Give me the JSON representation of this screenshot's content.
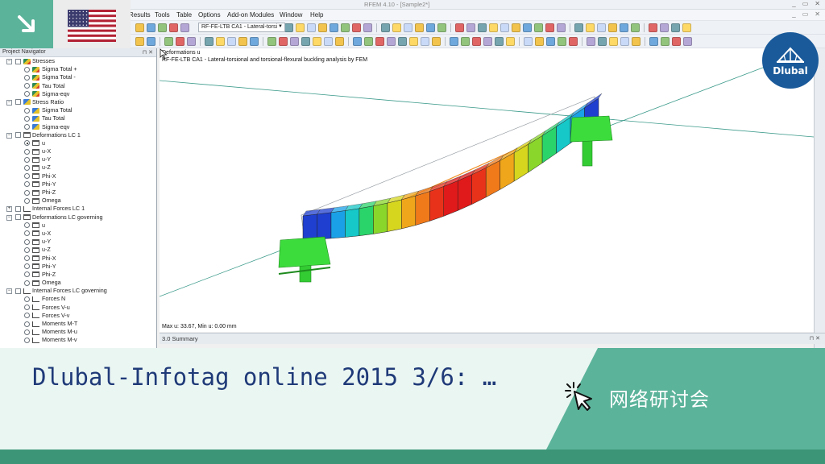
{
  "window": {
    "title": "RFEM 4.10 - [Sample2*]",
    "win_buttons": [
      "_",
      "▭",
      "✕"
    ]
  },
  "menu": {
    "items": [
      "Results",
      "Tools",
      "Table",
      "Options",
      "Add-on Modules",
      "Window",
      "Help"
    ]
  },
  "toolbar": {
    "load_case_select": "RF-FE-LTB CA1 - Lateral-torsi"
  },
  "navigator": {
    "title": "Project Navigator",
    "pin": "⊓ ✕",
    "rows": [
      {
        "level": 0,
        "type": "folder",
        "icon": "stress-icon",
        "label": "Stresses"
      },
      {
        "level": 1,
        "type": "radio",
        "icon": "stress-icon",
        "label": "Sigma Total +"
      },
      {
        "level": 1,
        "type": "radio",
        "icon": "stress-icon",
        "label": "Sigma Total -"
      },
      {
        "level": 1,
        "type": "radio",
        "icon": "stress-icon",
        "label": "Tau Total"
      },
      {
        "level": 1,
        "type": "radio",
        "icon": "stress-icon",
        "label": "Sigma-eqv"
      },
      {
        "level": 0,
        "type": "folder",
        "icon": "ratio-icon",
        "label": "Stress Ratio"
      },
      {
        "level": 1,
        "type": "radio",
        "icon": "ratio-icon",
        "label": "Sigma Total"
      },
      {
        "level": 1,
        "type": "radio",
        "icon": "ratio-icon",
        "label": "Tau Total"
      },
      {
        "level": 1,
        "type": "radio",
        "icon": "ratio-icon",
        "label": "Sigma-eqv"
      },
      {
        "level": 0,
        "type": "folder",
        "icon": "beam-icon",
        "label": "Deformations LC 1"
      },
      {
        "level": 1,
        "type": "radio",
        "icon": "beam-icon",
        "label": "u",
        "selected": true
      },
      {
        "level": 1,
        "type": "radio",
        "icon": "beam-icon",
        "label": "u-X"
      },
      {
        "level": 1,
        "type": "radio",
        "icon": "beam-icon",
        "label": "u-Y"
      },
      {
        "level": 1,
        "type": "radio",
        "icon": "beam-icon",
        "label": "u-Z"
      },
      {
        "level": 1,
        "type": "radio",
        "icon": "beam-icon",
        "label": "Phi-X"
      },
      {
        "level": 1,
        "type": "radio",
        "icon": "beam-icon",
        "label": "Phi-Y"
      },
      {
        "level": 1,
        "type": "radio",
        "icon": "beam-icon",
        "label": "Phi-Z"
      },
      {
        "level": 1,
        "type": "radio",
        "icon": "beam-icon",
        "label": "Omega"
      },
      {
        "level": 0,
        "type": "folder",
        "icon": "force-icon",
        "label": "Internal Forces LC 1",
        "collapsed": true
      },
      {
        "level": 0,
        "type": "folder",
        "icon": "beam-icon",
        "label": "Deformations LC governing"
      },
      {
        "level": 1,
        "type": "radio",
        "icon": "beam-icon",
        "label": "u"
      },
      {
        "level": 1,
        "type": "radio",
        "icon": "beam-icon",
        "label": "u-X"
      },
      {
        "level": 1,
        "type": "radio",
        "icon": "beam-icon",
        "label": "u-Y"
      },
      {
        "level": 1,
        "type": "radio",
        "icon": "beam-icon",
        "label": "u-Z"
      },
      {
        "level": 1,
        "type": "radio",
        "icon": "beam-icon",
        "label": "Phi-X"
      },
      {
        "level": 1,
        "type": "radio",
        "icon": "beam-icon",
        "label": "Phi-Y"
      },
      {
        "level": 1,
        "type": "radio",
        "icon": "beam-icon",
        "label": "Phi-Z"
      },
      {
        "level": 1,
        "type": "radio",
        "icon": "beam-icon",
        "label": "Omega"
      },
      {
        "level": 0,
        "type": "folder",
        "icon": "force-icon",
        "label": "Internal Forces LC governing"
      },
      {
        "level": 1,
        "type": "radio",
        "icon": "force-icon",
        "label": "Forces N"
      },
      {
        "level": 1,
        "type": "radio",
        "icon": "force-icon",
        "label": "Forces V-u"
      },
      {
        "level": 1,
        "type": "radio",
        "icon": "force-icon",
        "label": "Forces V-v"
      },
      {
        "level": 1,
        "type": "radio",
        "icon": "force-icon",
        "label": "Moments M-T"
      },
      {
        "level": 1,
        "type": "radio",
        "icon": "force-icon",
        "label": "Moments M-u"
      },
      {
        "level": 1,
        "type": "radio",
        "icon": "force-icon",
        "label": "Moments M-v"
      }
    ]
  },
  "view": {
    "line1": "Deformations u",
    "line2": "RF-FE-LTB CA1 - Lateral-torsional and torsional-flexural buckling analysis by FEM",
    "maxmin": "Max u: 33.67, Min u: 0.00 mm"
  },
  "summary": {
    "label": "3.0 Summary",
    "buttons": "⊓ ✕"
  },
  "overlay": {
    "title": "Dlubal-Infotag online 2015 3/6: …",
    "webinar_label": "网络研讨会",
    "logo_text": "Dlubal"
  },
  "colors": {
    "teal": "#5bb39a",
    "teal_dark": "#3d9578",
    "banner_light": "#eaf6f2",
    "title_blue": "#1f3a78",
    "logo_blue": "#1a5a9a",
    "support_green": "#33cc33"
  }
}
